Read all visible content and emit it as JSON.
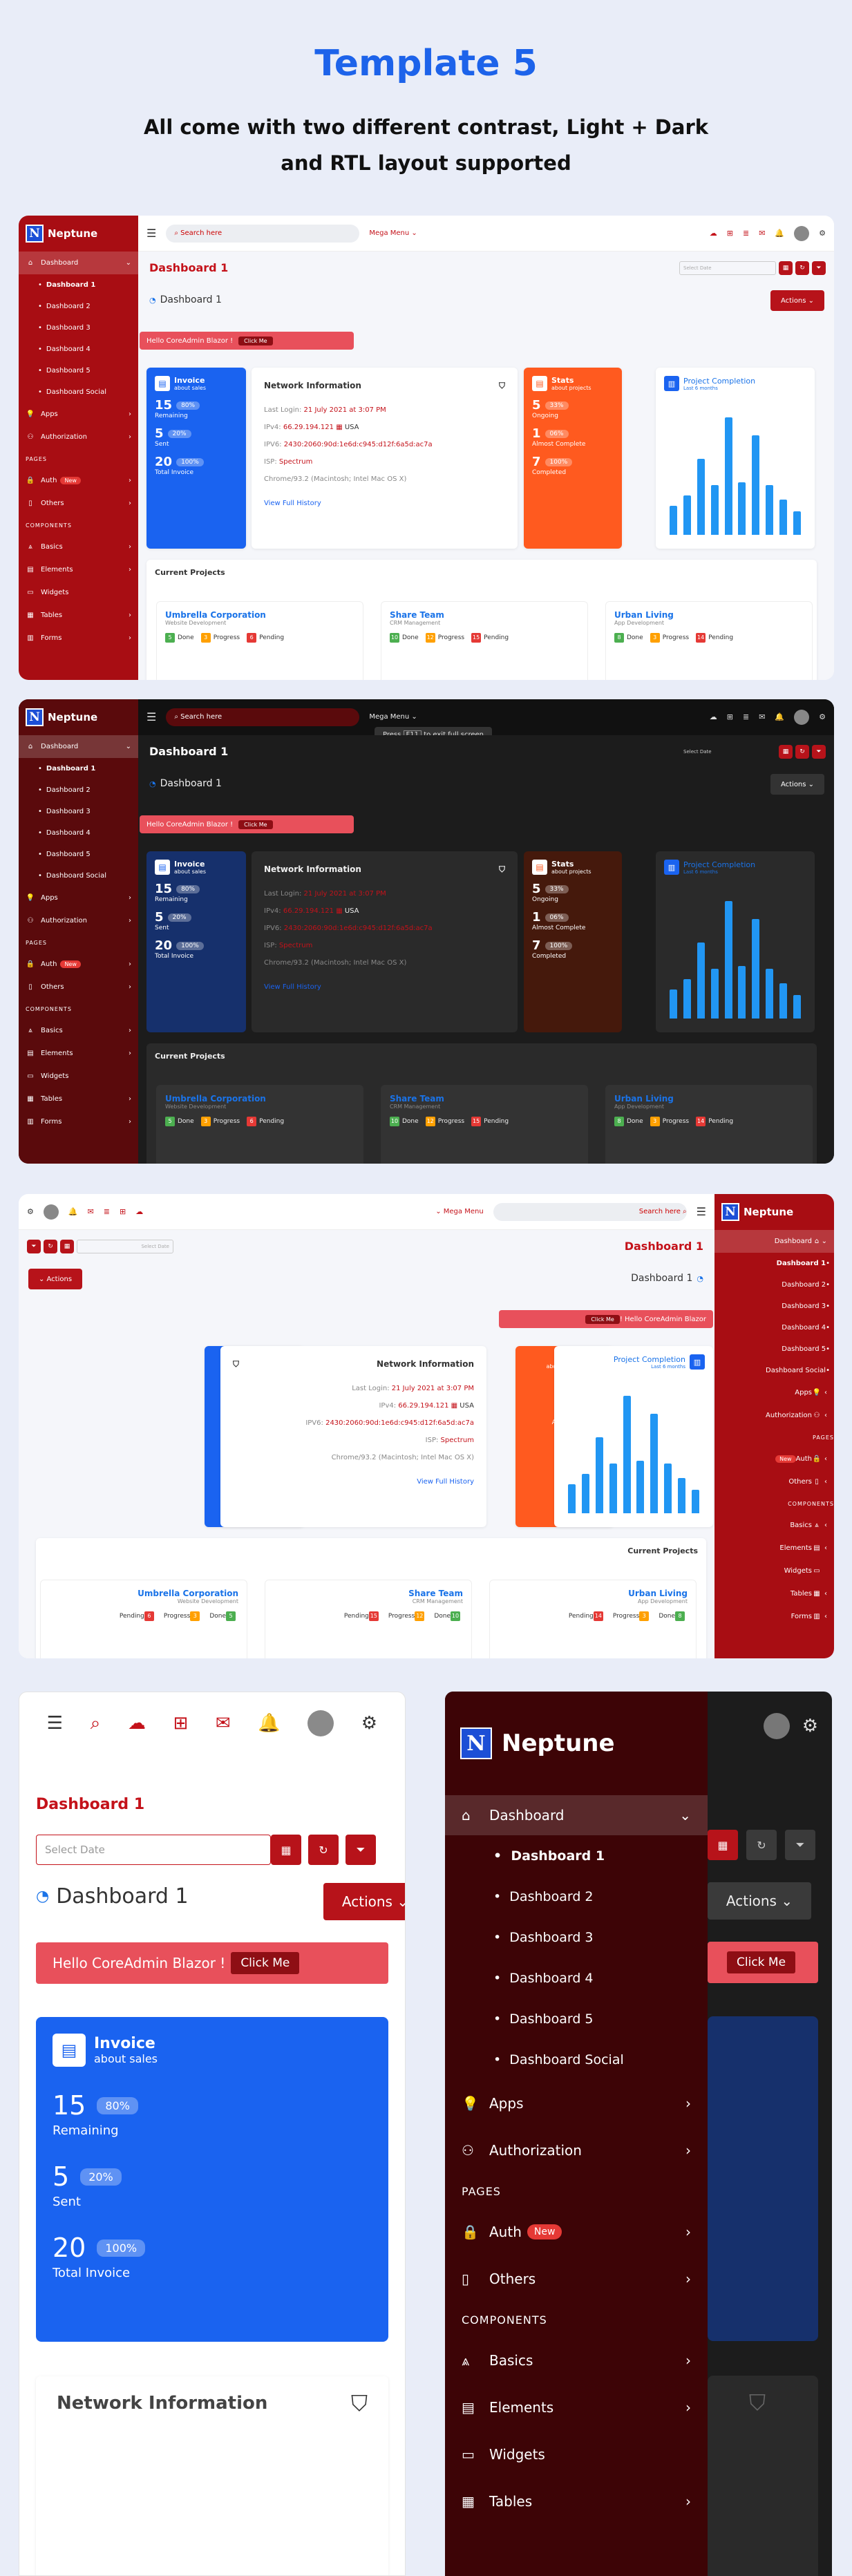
{
  "header": {
    "title": "Template 5",
    "subtitle_line1": "All come with two different contrast, Light + Dark",
    "subtitle_line2": "and RTL layout supported"
  },
  "brand": "Neptune",
  "sidebar": {
    "dashboard": "Dashboard",
    "subs": [
      "Dashboard 1",
      "Dashboard 2",
      "Dashboard 3",
      "Dashboard 4",
      "Dashboard 5",
      "Dashboard Social"
    ],
    "apps": "Apps",
    "authorization": "Authorization",
    "pages_section": "PAGES",
    "auth": "Auth",
    "new_badge": "New",
    "others": "Others",
    "components_section": "COMPONENTS",
    "basics": "Basics",
    "elements": "Elements",
    "widgets": "Widgets",
    "tables": "Tables",
    "forms": "Forms"
  },
  "topbar": {
    "search": "Search here",
    "mega_menu": "Mega Menu",
    "fullscreen_hint_pre": "Press",
    "fullscreen_key": "F11",
    "fullscreen_hint_post": "to exit full screen"
  },
  "page": {
    "title": "Dashboard 1",
    "breadcrumb": "Dashboard 1",
    "select_date": "Select Date",
    "actions": "Actions",
    "alert": "Hello CoreAdmin Blazor !",
    "click_me": "Click Me"
  },
  "invoice": {
    "title": "Invoice",
    "subtitle": "about sales",
    "rows": [
      {
        "value": "15",
        "pct": "80%",
        "label": "Remaining"
      },
      {
        "value": "5",
        "pct": "20%",
        "label": "Sent"
      },
      {
        "value": "20",
        "pct": "100%",
        "label": "Total Invoice"
      }
    ]
  },
  "network": {
    "title": "Network Information",
    "last_login_label": "Last Login:",
    "last_login": "21 July 2021 at 3:07 PM",
    "ipv4_label": "IPv4:",
    "ipv4": "66.29.194.121",
    "country": "USA",
    "ipv6_label": "IPV6:",
    "ipv6": "2430:2060:90d:1e6d:c945:d12f:6a5d:ac7a",
    "isp_label": "ISP:",
    "isp": "Spectrum",
    "browser": "Chrome/93.2 (Macintosh; Intel Mac OS X)",
    "link": "View Full History"
  },
  "stats": {
    "title": "Stats",
    "subtitle": "about projects",
    "rows": [
      {
        "value": "5",
        "pct": "33%",
        "label": "Ongoing"
      },
      {
        "value": "1",
        "pct": "06%",
        "label": "Almost Complete"
      },
      {
        "value": "7",
        "pct": "100%",
        "label": "Completed"
      }
    ]
  },
  "completion": {
    "title": "Project Completion",
    "subtitle": "Last 6 months"
  },
  "chart_data": {
    "type": "bar",
    "values": [
      22,
      30,
      58,
      38,
      90,
      40,
      76,
      38,
      27,
      18
    ]
  },
  "projects": {
    "title": "Current Projects",
    "items": [
      {
        "name": "Umbrella Corporation",
        "sub": "Website Development",
        "done": "5",
        "progress": "3",
        "pending": "6"
      },
      {
        "name": "Share Team",
        "sub": "CRM Management",
        "done": "10",
        "progress": "12",
        "pending": "15"
      },
      {
        "name": "Urban Living",
        "sub": "App Development",
        "done": "8",
        "progress": "3",
        "pending": "14"
      }
    ],
    "done_label": "Done",
    "progress_label": "Progress",
    "pending_label": "Pending"
  },
  "colors": {
    "brand_red": "#a80d13",
    "accent_blue": "#1a63f0",
    "accent_orange": "#ff5a1f",
    "page_bg": "#e9edf8"
  }
}
